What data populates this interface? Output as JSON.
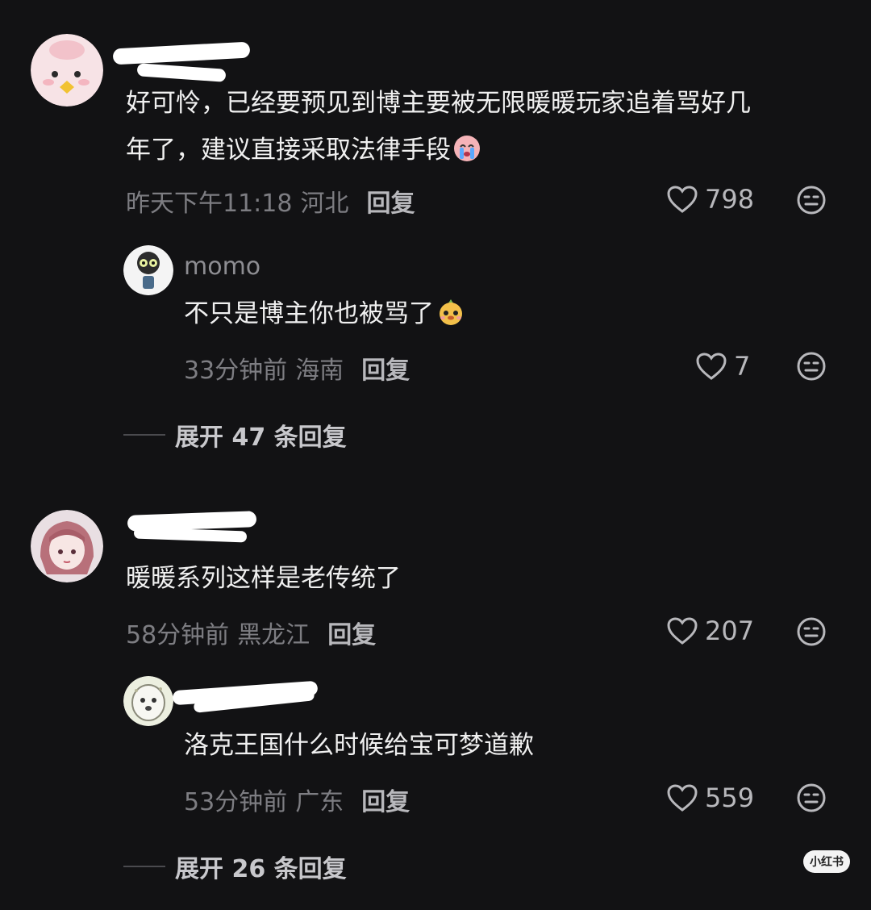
{
  "comments": [
    {
      "content_lines": [
        "好可怜，已经要预见到博主要被无限暖暖玩家追着骂好几",
        "年了，建议直接采取法律手段"
      ],
      "time": "昨天下午11:18",
      "location": "河北",
      "reply_label": "回复",
      "likes": "798",
      "replies": [
        {
          "username": "momo",
          "content": "不只是博主你也被骂了",
          "time": "33分钟前",
          "location": "海南",
          "reply_label": "回复",
          "likes": "7"
        }
      ],
      "expand_label": "展开 47 条回复"
    },
    {
      "content_lines": [
        "暖暖系列这样是老传统了"
      ],
      "time": "58分钟前",
      "location": "黑龙江",
      "reply_label": "回复",
      "likes": "207",
      "replies": [
        {
          "content": "洛克王国什么时候给宝可梦道歉",
          "time": "53分钟前",
          "location": "广东",
          "reply_label": "回复",
          "likes": "559"
        }
      ],
      "expand_label": "展开 26 条回复"
    }
  ],
  "watermark": "小红书",
  "icons": {
    "like": "heart-outline-icon",
    "emoji": "emoji-face-icon"
  },
  "colors": {
    "background": "#121214",
    "text": "#f0f0f0",
    "meta": "#7d7d82",
    "reply": "#b8b8bc"
  }
}
